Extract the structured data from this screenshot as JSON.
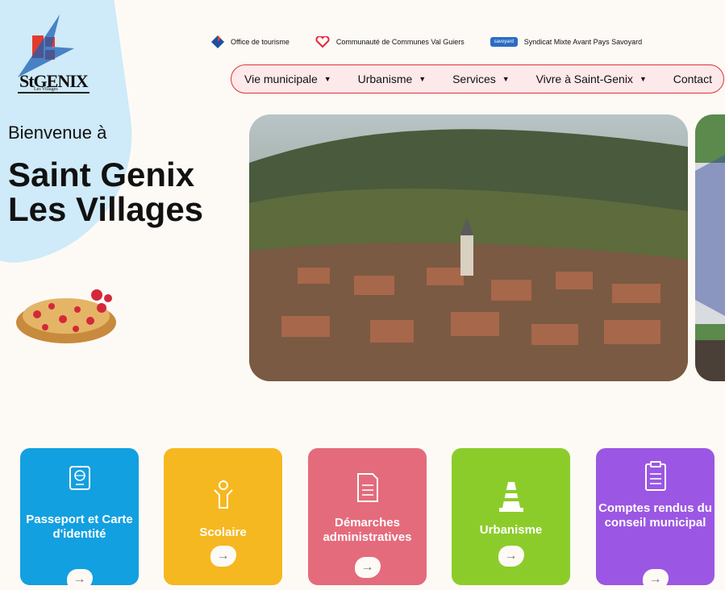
{
  "logo": {
    "text": "StGENIX",
    "sub": "Les Villages"
  },
  "toplinks": [
    {
      "label": "Office de tourisme",
      "icon": "tourism-icon"
    },
    {
      "label": "Communauté de Communes Val Guiers",
      "icon": "heart-icon"
    },
    {
      "label": "Syndicat Mixte Avant Pays Savoyard",
      "icon": "savoyard-logo",
      "badge": "savoyard"
    }
  ],
  "nav": {
    "items": [
      {
        "label": "Vie municipale",
        "has_dropdown": true
      },
      {
        "label": "Urbanisme",
        "has_dropdown": true
      },
      {
        "label": "Services",
        "has_dropdown": true
      },
      {
        "label": "Vivre à Saint-Genix",
        "has_dropdown": true
      },
      {
        "label": "Contact",
        "has_dropdown": false
      }
    ],
    "caret": "▼"
  },
  "hero": {
    "welcome": "Bienvenue à",
    "title": "Saint Genix Les Villages"
  },
  "cards": [
    {
      "label": "Passeport et Carte d'identité",
      "icon": "passport-icon",
      "color": "#12a0e0"
    },
    {
      "label": "Scolaire",
      "icon": "child-icon",
      "color": "#f5b820"
    },
    {
      "label": "Démarches administratives",
      "icon": "document-icon",
      "color": "#e46b7c"
    },
    {
      "label": "Urbanisme",
      "icon": "cone-icon",
      "color": "#8ccc2a"
    },
    {
      "label": "Comptes rendus du conseil municipal",
      "icon": "clipboard-icon",
      "color": "#9b57e3"
    }
  ],
  "arrow": "→"
}
